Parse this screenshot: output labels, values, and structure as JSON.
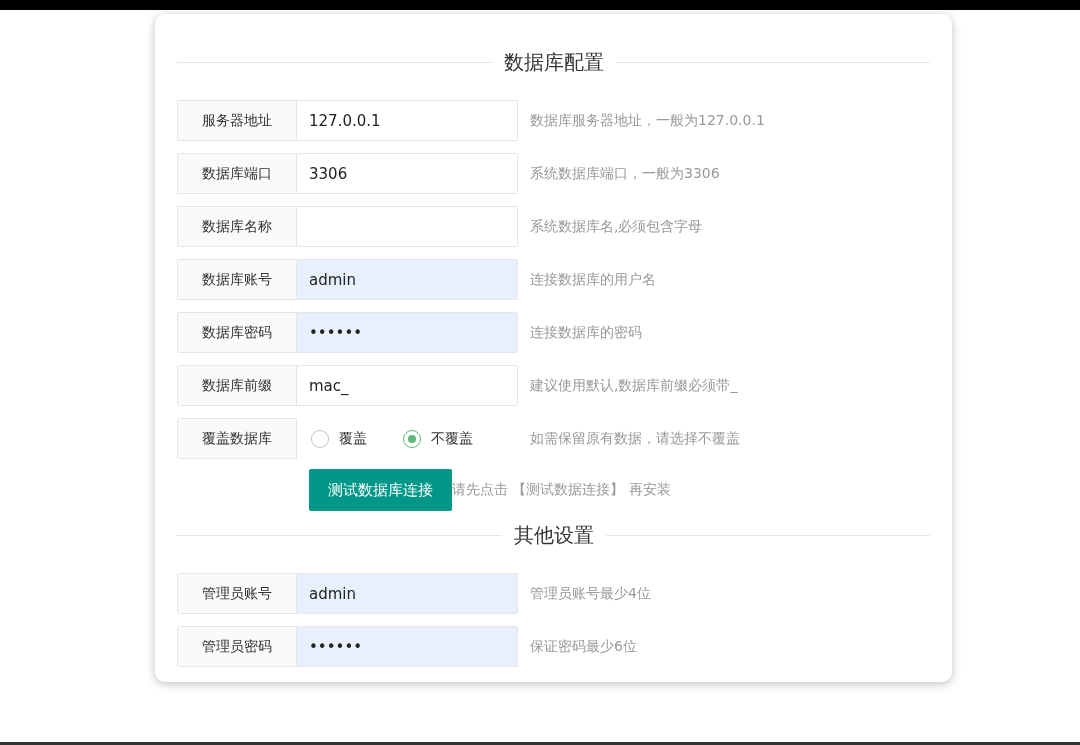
{
  "sections": [
    {
      "title": "数据库配置",
      "fields": [
        {
          "kind": "text",
          "label": "服务器地址",
          "value": "127.0.0.1",
          "autofilled": false,
          "hint": "数据库服务器地址，一般为127.0.0.1"
        },
        {
          "kind": "text",
          "label": "数据库端口",
          "value": "3306",
          "autofilled": false,
          "hint": "系统数据库端口，一般为3306"
        },
        {
          "kind": "text",
          "label": "数据库名称",
          "autofilled": false,
          "hint": "系统数据库名,必须包含字母"
        },
        {
          "kind": "text",
          "label": "数据库账号",
          "value": "admin",
          "autofilled": true,
          "hint": "连接数据库的用户名"
        },
        {
          "kind": "text",
          "label": "数据库密码",
          "value": "••••••",
          "autofilled": true,
          "hint": "连接数据库的密码"
        },
        {
          "kind": "text",
          "label": "数据库前缀",
          "value": "mac_",
          "autofilled": false,
          "hint": "建议使用默认,数据库前缀必须带_"
        },
        {
          "kind": "radio",
          "label": "覆盖数据库",
          "options": [
            {
              "label": "覆盖",
              "selected": false
            },
            {
              "label": "不覆盖",
              "selected": true
            }
          ],
          "hint": "如需保留原有数据，请选择不覆盖"
        }
      ],
      "action": {
        "button": "测试数据库连接",
        "note": "请先点击 【测试数据连接】 再安装"
      }
    },
    {
      "title": "其他设置",
      "fields": [
        {
          "kind": "text",
          "label": "管理员账号",
          "value": "admin",
          "autofilled": true,
          "hint": "管理员账号最少4位"
        },
        {
          "kind": "text",
          "label": "管理员密码",
          "value": "••••••",
          "autofilled": true,
          "hint": "保证密码最少6位"
        }
      ]
    }
  ]
}
